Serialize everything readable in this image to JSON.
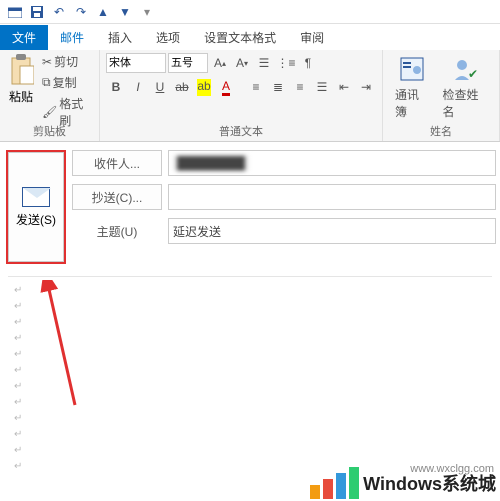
{
  "qat": {
    "undo": "↶",
    "redo": "↷"
  },
  "tabs": {
    "file": "文件",
    "mail": "邮件",
    "insert": "插入",
    "options": "选项",
    "format": "设置文本格式",
    "review": "审阅"
  },
  "ribbon": {
    "clipboard": {
      "paste": "粘贴",
      "cut": "剪切",
      "copy": "复制",
      "painter": "格式刷",
      "label": "剪贴板"
    },
    "font": {
      "name": "宋体",
      "size": "五号",
      "label": "普通文本"
    },
    "names": {
      "addr": "通讯簿",
      "check": "检查姓名",
      "label": "姓名"
    }
  },
  "compose": {
    "send": "发送(S)",
    "to_label": "收件人...",
    "to_value": "",
    "cc_label": "抄送(C)...",
    "cc_value": "",
    "subject_label": "主题(U)",
    "subject_value": "延迟发送"
  },
  "watermark": {
    "text": "Windows系统城",
    "sub": "www.wxclgg.com"
  }
}
